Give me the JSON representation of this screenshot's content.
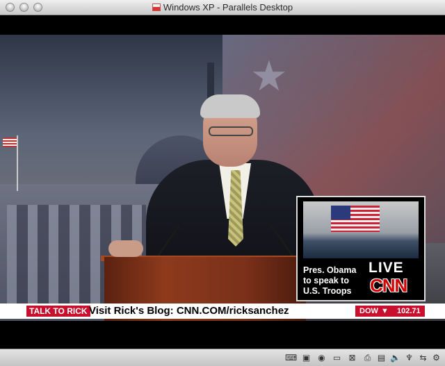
{
  "window": {
    "title": "Windows XP - Parallels Desktop",
    "buttons": [
      "close",
      "minimize",
      "zoom"
    ]
  },
  "broadcast": {
    "inset": {
      "caption_lines": [
        "Pres. Obama",
        "to speak to",
        "U.S. Troops"
      ],
      "live_label": "LIVE",
      "network_logo": "CNN"
    },
    "ticker": {
      "segment_label": "TALK TO RICK",
      "message": "Visit Rick's Blog: CNN.COM/ricksanchez",
      "index_name": "DOW",
      "index_direction": "down",
      "index_arrow": "▼",
      "index_value": "102.71"
    },
    "colors": {
      "cnn_red": "#c8102e"
    }
  },
  "statusbar": {
    "icons": [
      "keyboard-icon",
      "floppy-icon",
      "cd-icon",
      "hard-disk-icon",
      "network-icon",
      "printer-icon",
      "display-icon",
      "sound-icon",
      "usb-icon",
      "shared-folder-icon",
      "settings-icon"
    ],
    "glyphs": [
      "⌨",
      "▣",
      "◉",
      "▭",
      "⊠",
      "⎙",
      "▤",
      "🔈",
      "♆",
      "⇆",
      "⚙"
    ]
  }
}
